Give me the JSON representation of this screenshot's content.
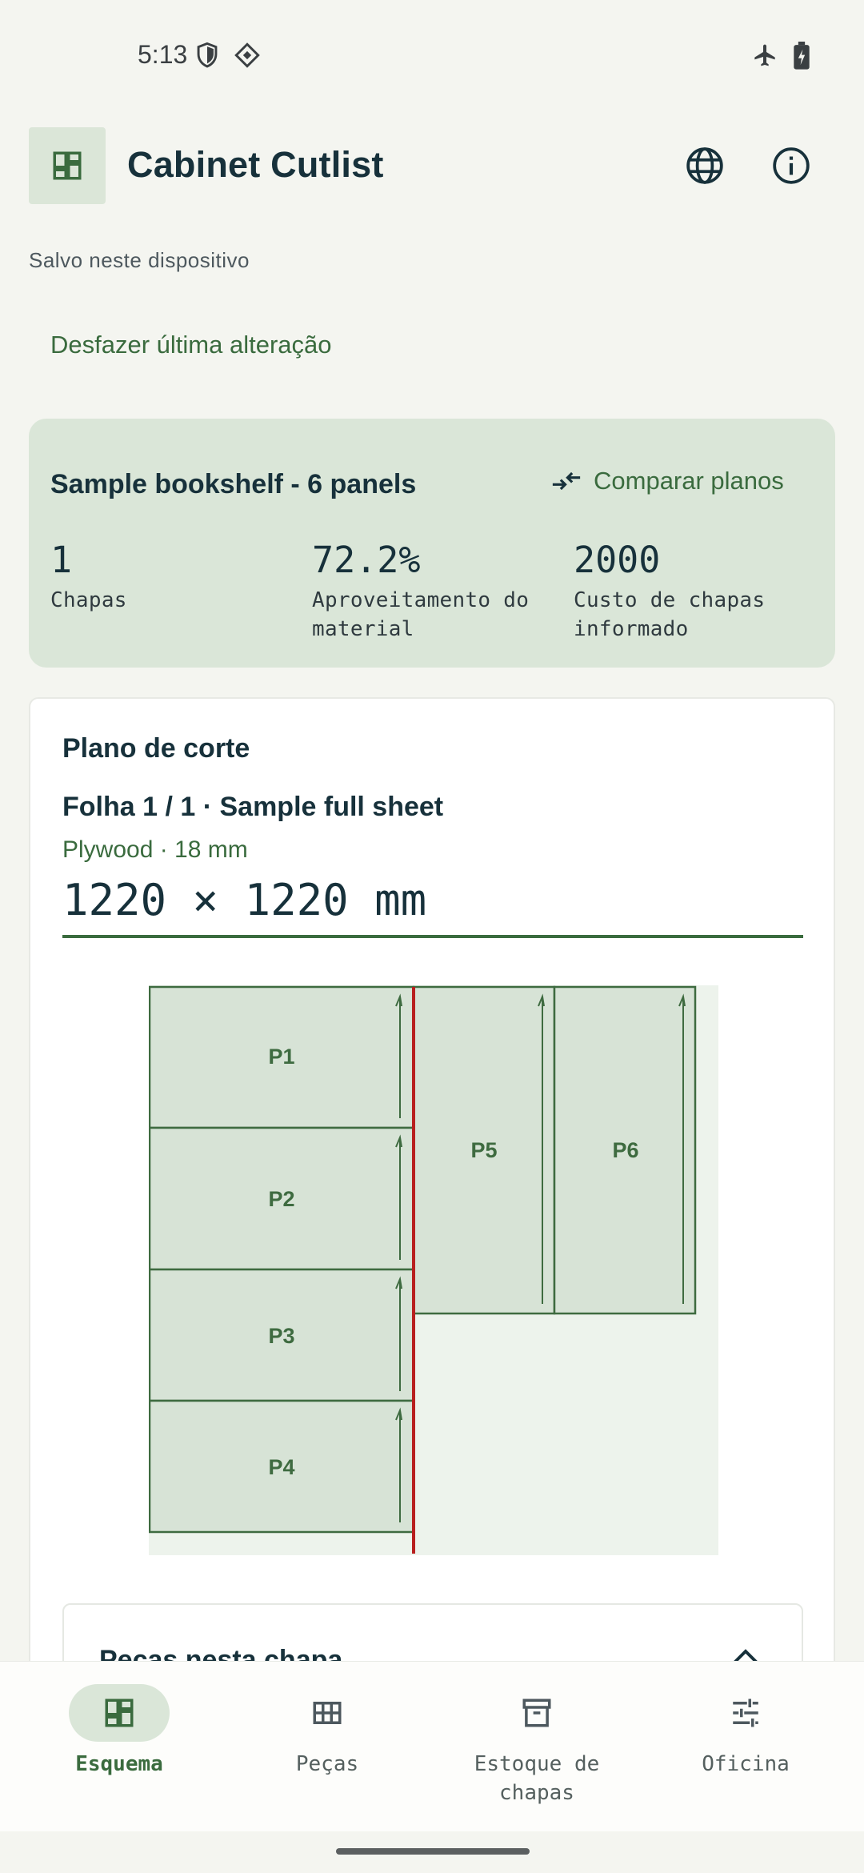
{
  "status_bar": {
    "time": "5:13"
  },
  "app": {
    "title": "Cabinet Cutlist"
  },
  "save_status": "Salvo neste dispositivo",
  "undo_label": "Desfazer última alteração",
  "summary": {
    "plan_name": "Sample bookshelf - 6 panels",
    "compare_label": "Comparar planos",
    "stats": [
      {
        "value": "1",
        "label": "Chapas"
      },
      {
        "value": "72.2%",
        "label": "Aproveitamento do material"
      },
      {
        "value": "2000",
        "label": "Custo de chapas informado"
      }
    ]
  },
  "cut_plan": {
    "heading": "Plano de corte",
    "sheet_title": "Folha 1 / 1 · Sample full sheet",
    "material": "Plywood · 18 mm",
    "dimensions": "1220 × 1220 mm",
    "pieces": [
      {
        "label": "P1"
      },
      {
        "label": "P2"
      },
      {
        "label": "P3"
      },
      {
        "label": "P4"
      },
      {
        "label": "P5"
      },
      {
        "label": "P6"
      }
    ],
    "colors": {
      "piece_fill": "#d7e3d6",
      "piece_stroke": "#3e6b40",
      "cut_line": "#b81f1f",
      "sheet_bg": "#edf3ec"
    }
  },
  "pieces_panel": {
    "title": "Peças nesta chapa"
  },
  "bottom_nav": [
    {
      "label": "Esquema",
      "icon": "dashboard-icon",
      "active": true
    },
    {
      "label": "Peças",
      "icon": "grid-icon",
      "active": false
    },
    {
      "label": "Estoque de chapas",
      "icon": "archive-icon",
      "active": false
    },
    {
      "label": "Oficina",
      "icon": "tune-icon",
      "active": false
    }
  ]
}
